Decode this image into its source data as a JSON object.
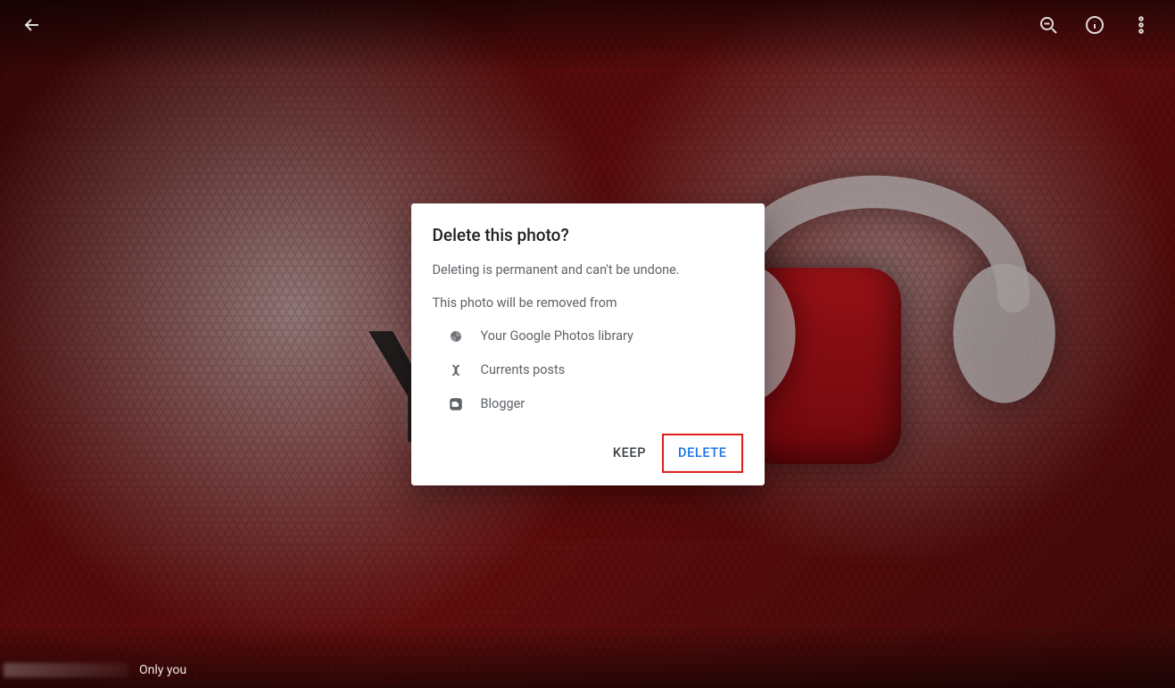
{
  "toolbar": {
    "back_tooltip": "Back",
    "zoom_tooltip": "Zoom out",
    "info_tooltip": "Info",
    "more_tooltip": "More options"
  },
  "footer": {
    "visibility_label": "Only you"
  },
  "dialog": {
    "title": "Delete this photo?",
    "warning": "Deleting is permanent and can't be undone.",
    "removed_from_intro": "This photo will be removed from",
    "items": [
      {
        "icon": "google-photos-icon",
        "label": "Your Google Photos library"
      },
      {
        "icon": "currents-icon",
        "label": "Currents posts"
      },
      {
        "icon": "blogger-icon",
        "label": "Blogger"
      }
    ],
    "keep_label": "KEEP",
    "delete_label": "DELETE"
  }
}
